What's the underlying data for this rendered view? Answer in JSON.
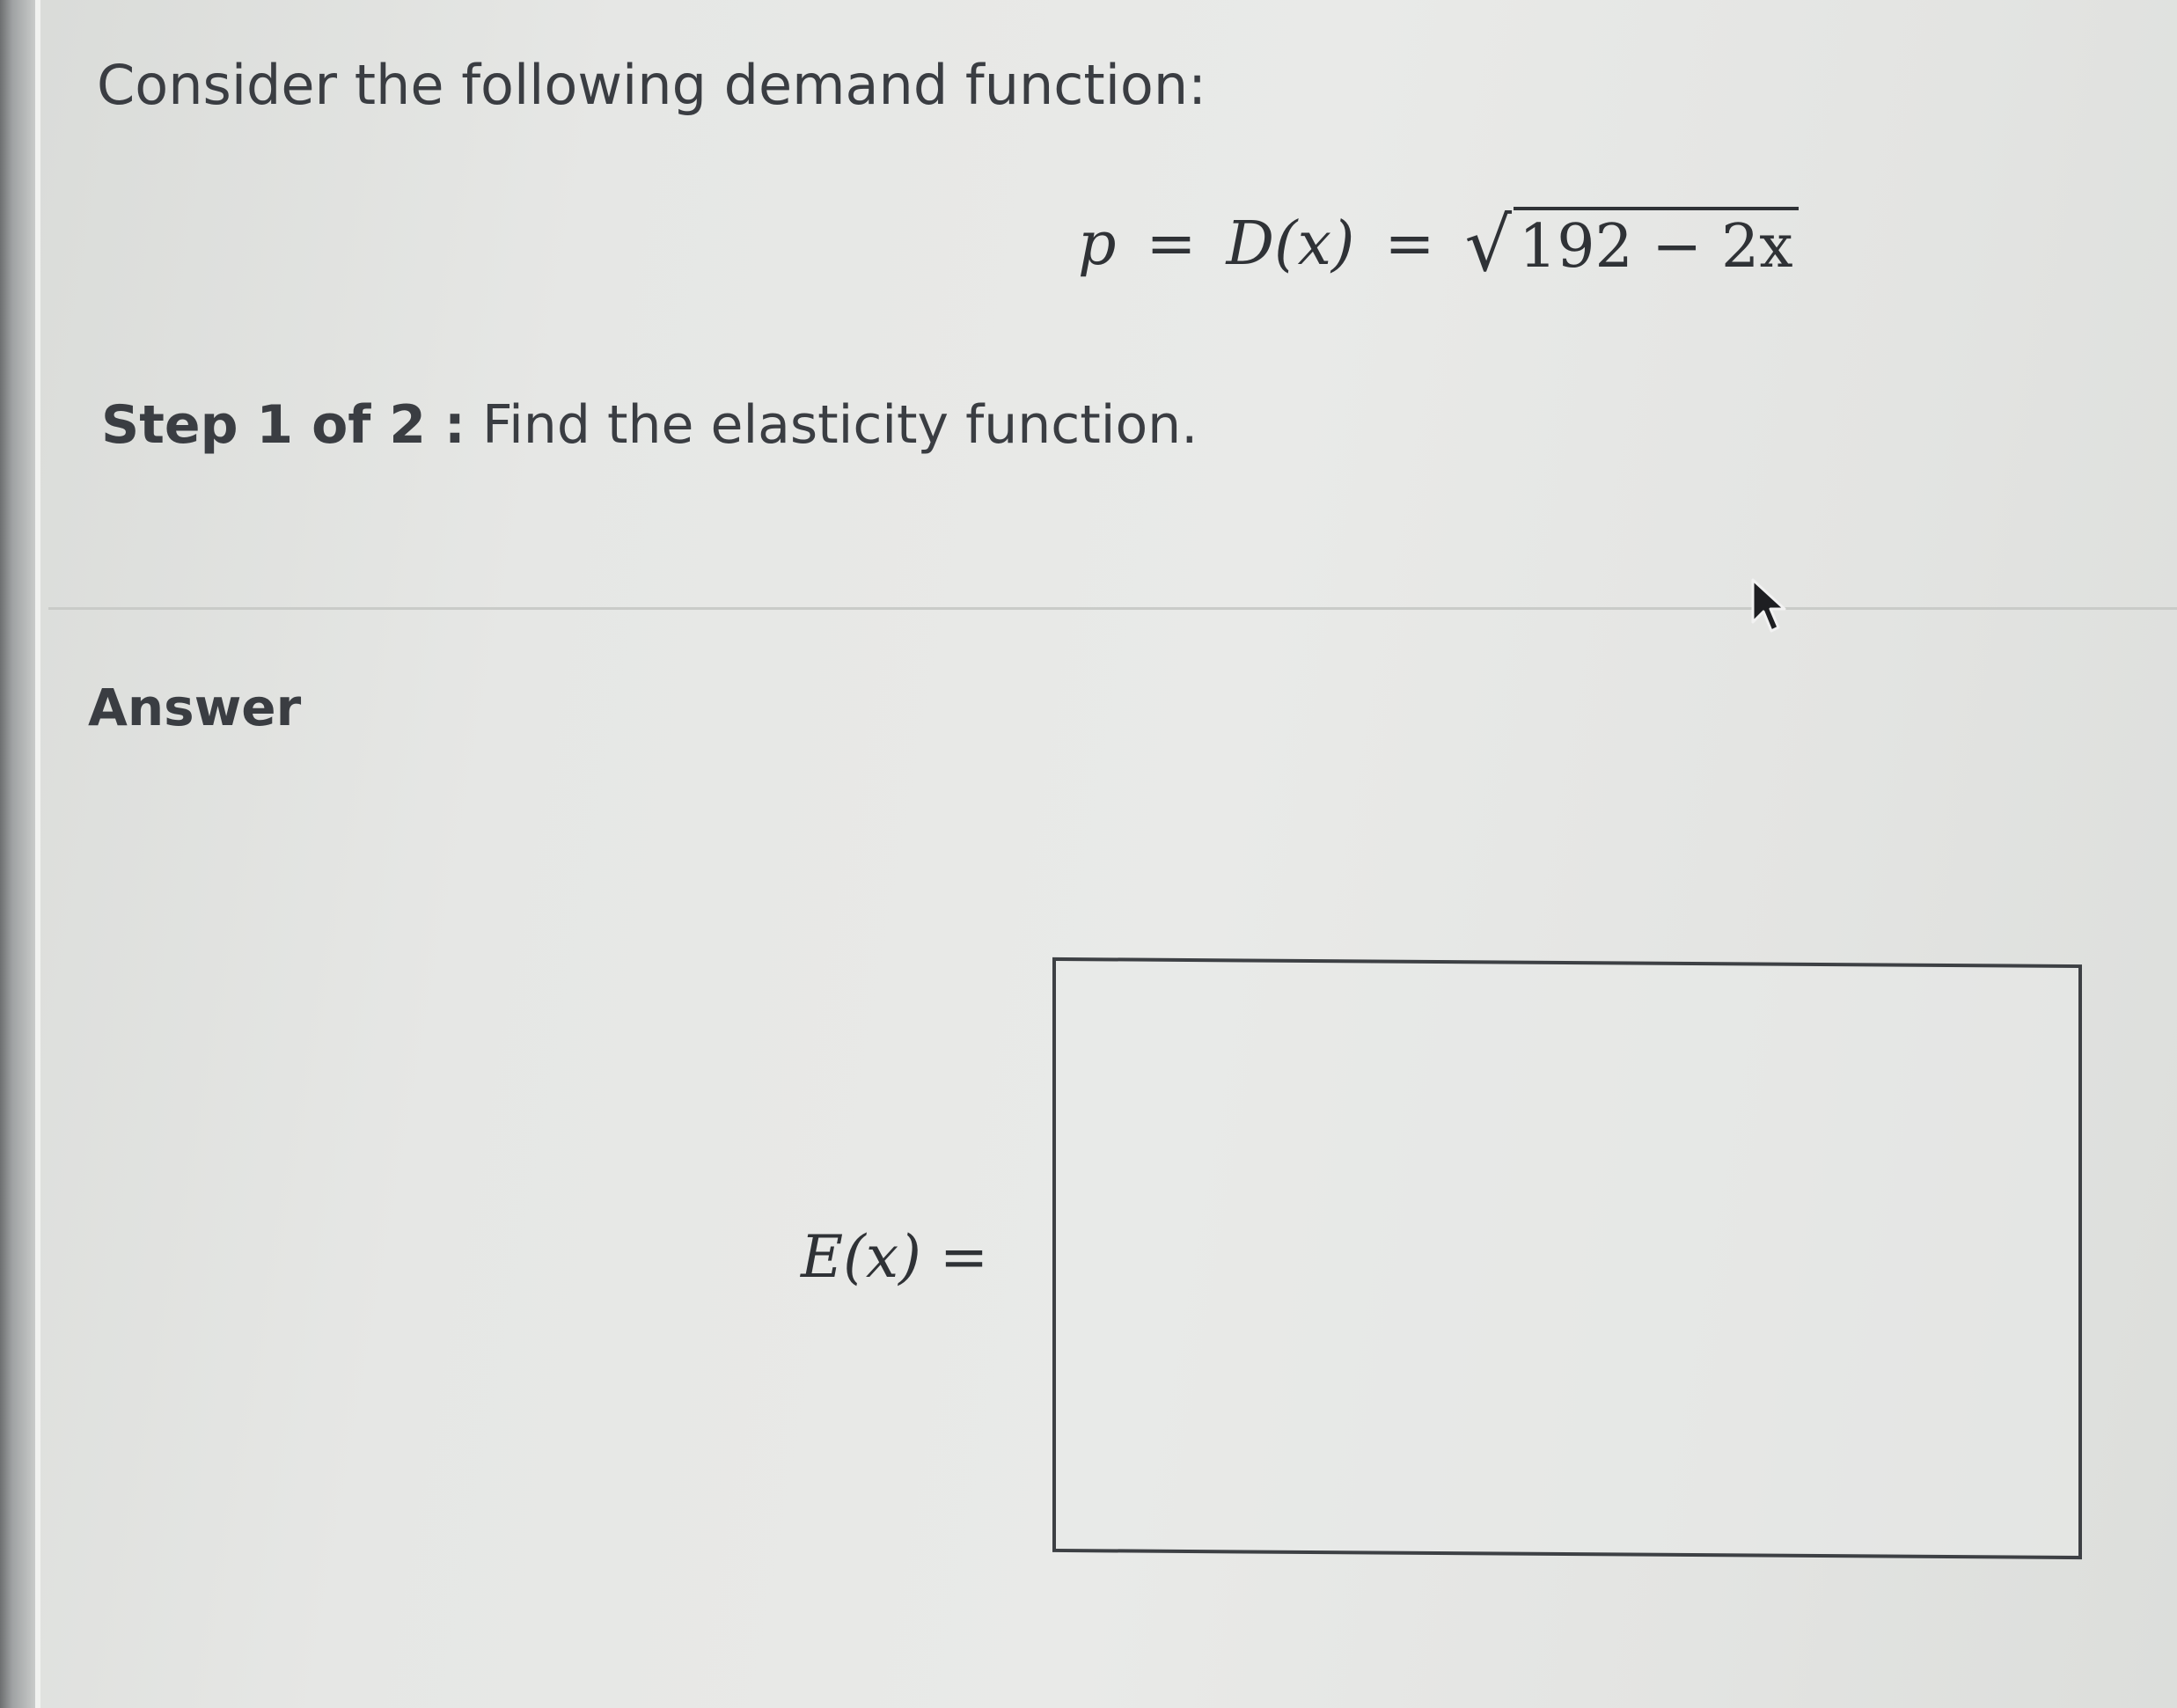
{
  "question": {
    "prompt": "Consider the following demand function:",
    "equation": {
      "lhs_var": "p",
      "equals": "=",
      "func": "D(x)",
      "radicand": "192 − 2x",
      "radical_symbol": "√"
    },
    "step_label": "Step 1 of 2 :",
    "step_text": "Find the elasticity function."
  },
  "answer": {
    "heading": "Answer",
    "label": "E(x)",
    "equals": "=",
    "input_value": ""
  },
  "icons": {
    "cursor": "mouse-pointer-icon"
  },
  "colors": {
    "text": "#3a3d42",
    "math": "#2f3236",
    "box_border": "#3d4044",
    "divider": "#c9cbc8"
  }
}
